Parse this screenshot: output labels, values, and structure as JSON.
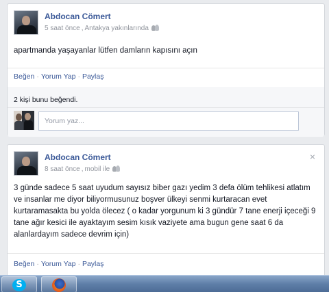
{
  "posts": [
    {
      "author": "Abdocan Cömert",
      "time": "5 saat önce",
      "location": "Antakya yakınlarında",
      "text": "apartmanda yaşayanlar lütfen damların kapısını açın",
      "actions": {
        "like": "Beğen",
        "comment": "Yorum Yap",
        "share": "Paylaş"
      },
      "likes": "2 kişi bunu beğendi.",
      "comment_placeholder": "Yorum yaz..."
    },
    {
      "author": "Abdocan Cömert",
      "time": "8 saat önce",
      "location": "mobil ile",
      "close": "×",
      "text": "3 günde sadece 5 saat uyudum sayısız biber gazı yedim 3 defa ölüm tehlikesi atlatım ve insanlar me diyor biliyormusunuz boşver ülkeyi senmi kurtaracan evet kurtaramasakta bu yolda ölecez ( o kadar yorgunum ki 3 gündür 7 tane enerji içeceği 9 tane ağır kesici ile ayaktayım sesim kısık vaziyete ama bugun gene saat 6 da alanlardayım sadece devrim için)",
      "actions": {
        "like": "Beğen",
        "comment": "Yorum Yap",
        "share": "Paylaş"
      }
    }
  ],
  "taskbar": {
    "items": [
      {
        "icon": "skype-icon",
        "glyph": "S",
        "color": "#00aff0"
      },
      {
        "icon": "firefox-icon",
        "color": "#e2571e"
      }
    ]
  },
  "colors": {
    "link": "#3b5998",
    "meta": "#90949c",
    "background": "#e9ebee"
  }
}
